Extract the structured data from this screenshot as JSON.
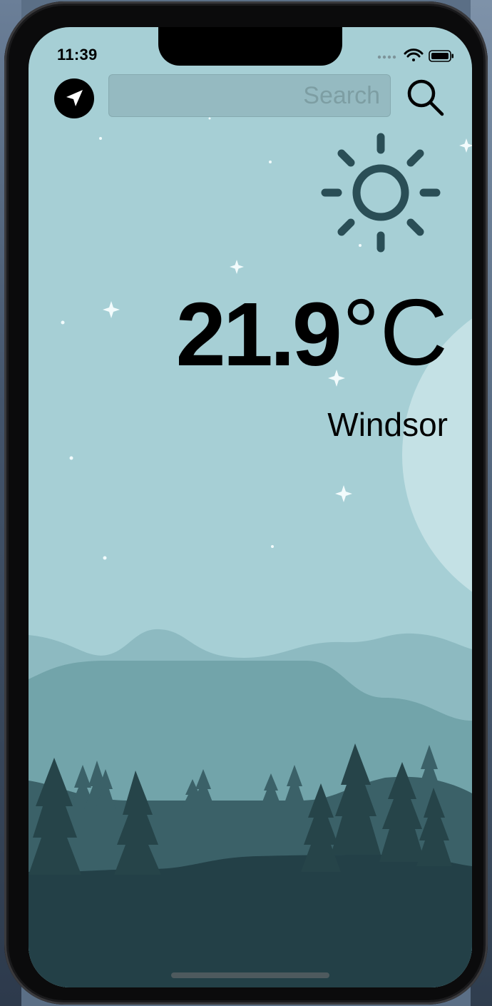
{
  "status_bar": {
    "time": "11:39"
  },
  "search": {
    "placeholder": "Search",
    "value": ""
  },
  "icons": {
    "location": "location-arrow-icon",
    "search": "magnifier-icon",
    "weather": "sun-icon",
    "signal": "cellular-signal-icon",
    "wifi": "wifi-icon",
    "battery": "battery-icon"
  },
  "weather": {
    "temperature": "21.9",
    "unit": "°C",
    "city": "Windsor",
    "condition_icon": "sun-icon"
  },
  "colors": {
    "sky": "#a6cfd5",
    "hill_far": "#8dbac1",
    "hill_mid": "#72a4aa",
    "hill_near": "#3b6168",
    "ground": "#234047",
    "sun_icon": "#2a4e56"
  }
}
